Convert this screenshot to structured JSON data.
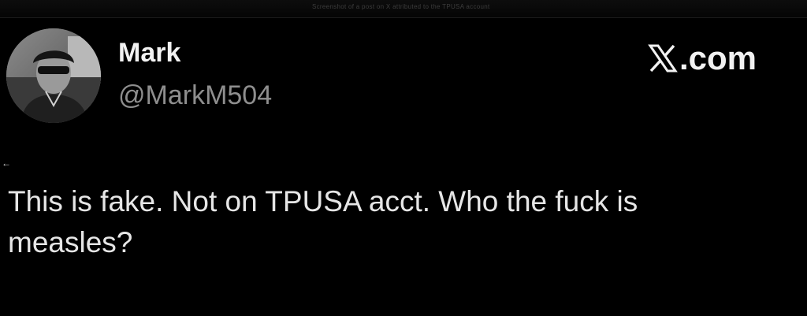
{
  "header": {
    "top_caption": "Screenshot of a post on X attributed to the TPUSA account"
  },
  "author": {
    "display_name": "Mark",
    "handle": "@MarkM504",
    "avatar_icon": "profile-photo"
  },
  "brand": {
    "icon": "x-logo-icon",
    "label": ".com"
  },
  "nav": {
    "back_arrow": "←"
  },
  "post": {
    "text": "This is fake. Not on TPUSA acct. Who the fuck is\nmeasles?"
  },
  "colors": {
    "background": "#000000",
    "name": "#f2f2f2",
    "handle": "#8e8e8e",
    "body_text": "#e6e6e6"
  }
}
